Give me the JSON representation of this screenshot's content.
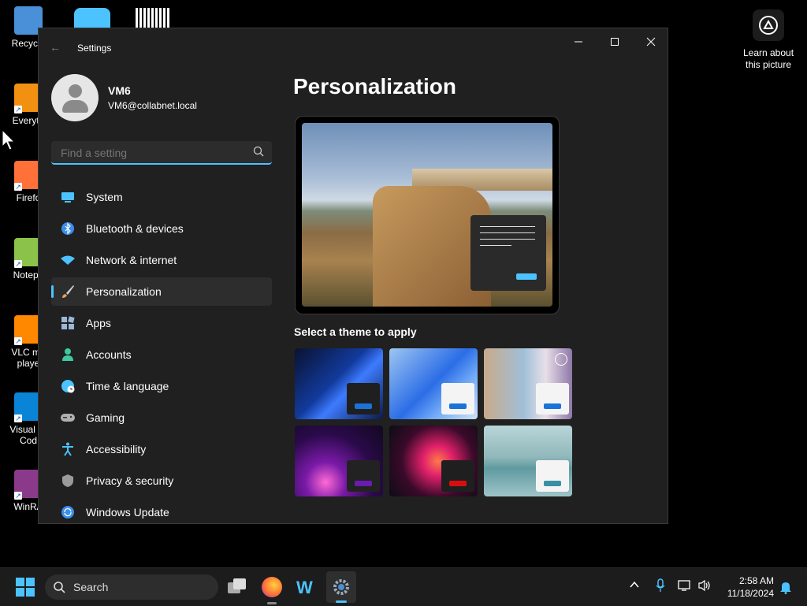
{
  "desktop_icons": [
    {
      "label": "Recycle",
      "icon": "recycle-bin-icon",
      "color": "#4a90d9"
    },
    {
      "label": "Everyth",
      "icon": "everything-search-icon",
      "color": "#f29111"
    },
    {
      "label": "Firefo",
      "icon": "firefox-icon",
      "color": "#ff7139"
    },
    {
      "label": "Notepa",
      "icon": "notepad-plus-plus-icon",
      "color": "#8bc34a"
    },
    {
      "label": "VLC me\nplaye",
      "icon": "vlc-icon",
      "color": "#ff8800"
    },
    {
      "label": "Visual St\nCod",
      "icon": "vscode-icon",
      "color": "#0a84d6"
    },
    {
      "label": "WinRA",
      "icon": "winrar-icon",
      "color": "#8b3a8b"
    }
  ],
  "learn_about": "Learn about this picture",
  "window": {
    "title": "Settings",
    "user": {
      "name": "VM6",
      "email": "VM6@collabnet.local"
    },
    "search_placeholder": "Find a setting",
    "nav": [
      {
        "label": "System",
        "icon": "display-icon",
        "color": "#4cc2ff",
        "active": false
      },
      {
        "label": "Bluetooth & devices",
        "icon": "bluetooth-icon",
        "color": "#3b8eea",
        "active": false
      },
      {
        "label": "Network & internet",
        "icon": "wifi-icon",
        "color": "#4cc2ff",
        "active": false
      },
      {
        "label": "Personalization",
        "icon": "brush-icon",
        "color": "#e8a55b",
        "active": true
      },
      {
        "label": "Apps",
        "icon": "apps-icon",
        "color": "#9bb7d4",
        "active": false
      },
      {
        "label": "Accounts",
        "icon": "person-icon",
        "color": "#3ec99e",
        "active": false
      },
      {
        "label": "Time & language",
        "icon": "globe-clock-icon",
        "color": "#4cc2ff",
        "active": false
      },
      {
        "label": "Gaming",
        "icon": "gamepad-icon",
        "color": "#b0b0b0",
        "active": false
      },
      {
        "label": "Accessibility",
        "icon": "accessibility-icon",
        "color": "#4cc2ff",
        "active": false
      },
      {
        "label": "Privacy & security",
        "icon": "shield-icon",
        "color": "#9a9a9a",
        "active": false
      },
      {
        "label": "Windows Update",
        "icon": "update-icon",
        "color": "#3b8eea",
        "active": false
      }
    ],
    "page_title": "Personalization",
    "themes_heading": "Select a theme to apply",
    "themes": [
      {
        "name": "dark-bloom",
        "bg": "linear-gradient(135deg,#0a1230 0%,#123a9c 45%,#3d7bff 60%,#0a1a4a 100%)",
        "mini": "#1f1f1f",
        "bar": "#1a73d9"
      },
      {
        "name": "light-bloom",
        "bg": "linear-gradient(135deg,#9ec6f2 0%,#2b6de6 50%,#6fa8f7 70%,#cfe3fb 100%)",
        "mini": "#f4f4f4",
        "bar": "#1a73d9"
      },
      {
        "name": "flowers",
        "bg": "linear-gradient(90deg,#caa98a 0%,#9fc0d8 45%,#e8dfe8 70%,#8d78a8 100%)",
        "mini": "#f4f4f4",
        "bar": "#1a73d9"
      },
      {
        "name": "glow",
        "bg": "radial-gradient(circle at 35% 80%,#ff6ad5 0%,#7a1aa8 25%,#2a0a4a 60%,#120820 100%)",
        "mini": "#222",
        "bar": "#6a1bb0"
      },
      {
        "name": "captured-motion",
        "bg": "radial-gradient(circle at 55% 50%,#ff7a4a 0%,#e0206a 25%,#3a0a2a 60%,#0c0c14 100%)",
        "mini": "#1f1f1f",
        "bar": "#d80e0e"
      },
      {
        "name": "sunrise",
        "bg": "linear-gradient(180deg,#b9d6d9 0%,#8fb7b9 45%,#5f9aa0 60%,#9fc4c8 100%)",
        "mini": "#f4f4f4",
        "bar": "#3a8fa4"
      }
    ]
  },
  "taskbar": {
    "search_label": "Search",
    "time": "2:58 AM",
    "date": "11/18/2024"
  }
}
